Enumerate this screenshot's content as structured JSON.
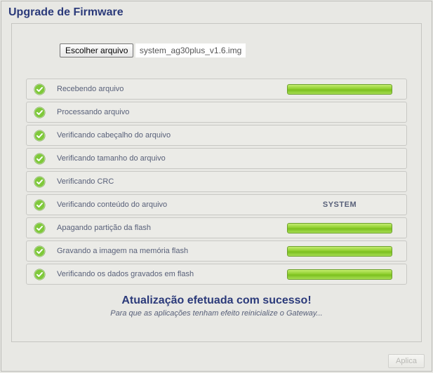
{
  "title": "Upgrade de Firmware",
  "file": {
    "button_label": "Escolher arquivo",
    "filename": "system_ag30plus_v1.6.img"
  },
  "steps": [
    {
      "label": "Recebendo arquivo",
      "progress": true,
      "detail": ""
    },
    {
      "label": "Processando arquivo",
      "progress": false,
      "detail": ""
    },
    {
      "label": "Verificando cabeçalho do arquivo",
      "progress": false,
      "detail": ""
    },
    {
      "label": "Verificando tamanho do arquivo",
      "progress": false,
      "detail": ""
    },
    {
      "label": "Verificando CRC",
      "progress": false,
      "detail": ""
    },
    {
      "label": "Verificando conteúdo do arquivo",
      "progress": false,
      "detail": "SYSTEM"
    },
    {
      "label": "Apagando partição da flash",
      "progress": true,
      "detail": ""
    },
    {
      "label": "Gravando a imagem na memória flash",
      "progress": true,
      "detail": ""
    },
    {
      "label": "Verificando os dados gravados em flash",
      "progress": true,
      "detail": ""
    }
  ],
  "result": {
    "heading": "Atualização efetuada com sucesso!",
    "subtext": "Para que as aplicações tenham efeito reinicialize o Gateway..."
  },
  "actions": {
    "apply_label": "Aplica"
  }
}
